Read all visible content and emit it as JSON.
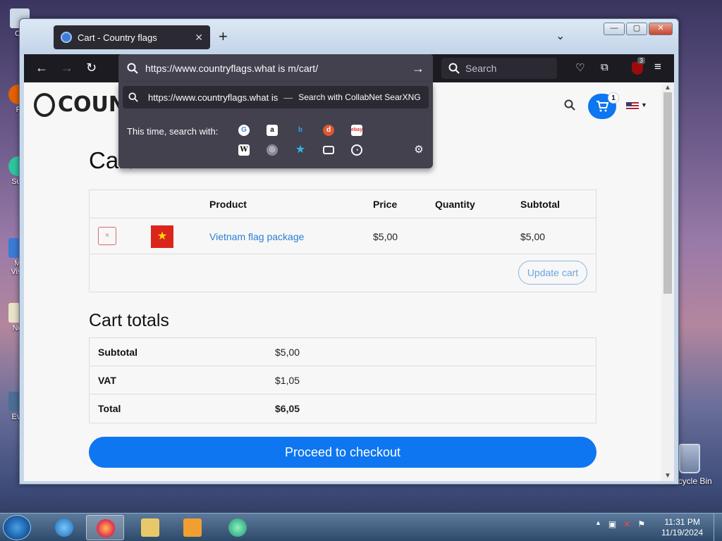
{
  "desktop": {
    "icons": [
      {
        "label": "Co"
      },
      {
        "label": "F"
      },
      {
        "label": "Sup"
      },
      {
        "label": "Mi"
      },
      {
        "label": "Visu"
      },
      {
        "label": "Not"
      },
      {
        "label": "Eve"
      }
    ],
    "recycle_bin": "Recycle Bin"
  },
  "browser": {
    "tab": {
      "title": "Cart - Country flags",
      "close": "✕"
    },
    "new_tab": "+",
    "list_tabs": "⌄",
    "window_buttons": {
      "minimize": "—",
      "maximize": "▢",
      "close": "✕"
    },
    "url": "https://www.countryflags.what is m/cart/",
    "go": "→",
    "search_placeholder": "Search",
    "ublock_badge": "3",
    "dropdown": {
      "suggestion_url": "https://www.countryflags.what is",
      "suggestion_dash": "—",
      "suggestion_engine": "Search with CollabNet SearXNG",
      "search_with_label": "This time, search with:",
      "engines": [
        "google-icon",
        "amazon-icon",
        "bing-icon",
        "duckduckgo-icon",
        "ebay-icon",
        "wikipedia-icon",
        "searxng-icon",
        "bookmarks-icon",
        "tabs-icon",
        "history-icon",
        "settings-icon"
      ]
    }
  },
  "site": {
    "logo_text": "COUNT",
    "cart_count": "1",
    "cart_heading": "Cart",
    "table": {
      "headers": {
        "product": "Product",
        "price": "Price",
        "quantity": "Quantity",
        "subtotal": "Subtotal"
      },
      "rows": [
        {
          "remove": "×",
          "flag": "★",
          "product": "Vietnam flag package",
          "price": "$5,00",
          "subtotal": "$5,00"
        }
      ],
      "update_label": "Update cart"
    },
    "totals_heading": "Cart totals",
    "totals": [
      {
        "label": "Subtotal",
        "value": "$5,00"
      },
      {
        "label": "VAT",
        "value": "$1,05"
      },
      {
        "label": "Total",
        "value": "$6,05"
      }
    ],
    "checkout_label": "Proceed to checkout"
  },
  "taskbar": {
    "time": "11:31 PM",
    "date": "11/19/2024",
    "tray_arrow": "▲"
  }
}
